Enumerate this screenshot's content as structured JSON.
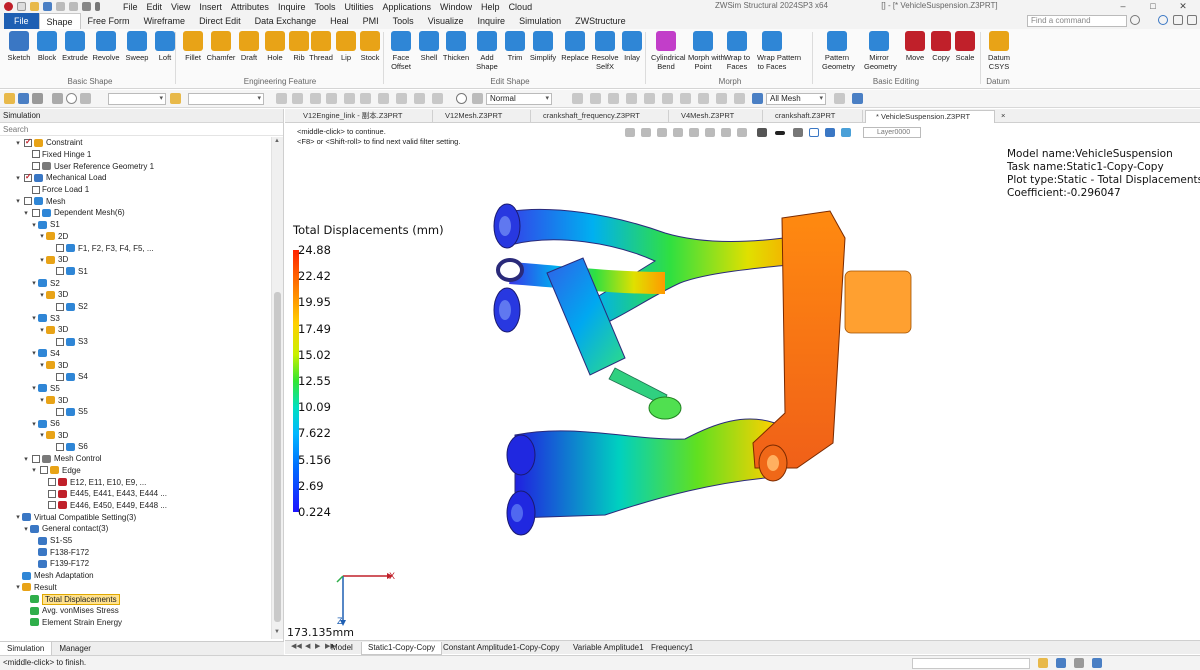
{
  "app": {
    "title": "ZWSim Structural 2024SP3 x64",
    "document": "[] - [* VehicleSuspension.Z3PRT]"
  },
  "menu": [
    "File",
    "Edit",
    "View",
    "Insert",
    "Attributes",
    "Inquire",
    "Tools",
    "Utilities",
    "Applications",
    "Window",
    "Help",
    "Cloud"
  ],
  "ribbon_tabs": [
    {
      "label": "File",
      "style": "file"
    },
    {
      "label": "Shape",
      "style": "active"
    },
    {
      "label": "Free Form",
      "style": ""
    },
    {
      "label": "Wireframe",
      "style": ""
    },
    {
      "label": "Direct Edit",
      "style": ""
    },
    {
      "label": "Data Exchange",
      "style": ""
    },
    {
      "label": "Heal",
      "style": ""
    },
    {
      "label": "PMI",
      "style": ""
    },
    {
      "label": "Tools",
      "style": ""
    },
    {
      "label": "Visualize",
      "style": ""
    },
    {
      "label": "Inquire",
      "style": ""
    },
    {
      "label": "Simulation",
      "style": ""
    },
    {
      "label": "ZWStructure",
      "style": ""
    }
  ],
  "find_command": {
    "placeholder": "Find a command"
  },
  "ribbon": {
    "tools": [
      {
        "label": "Sketch",
        "name": "sketch-icon",
        "color": "#3a77c4"
      },
      {
        "label": "Block",
        "name": "block-icon",
        "color": "#2f86d6"
      },
      {
        "label": "Extrude",
        "name": "extrude-icon",
        "color": "#2f86d6"
      },
      {
        "label": "Revolve",
        "name": "revolve-icon",
        "color": "#2f86d6"
      },
      {
        "label": "Sweep",
        "name": "sweep-icon",
        "color": "#2f86d6"
      },
      {
        "label": "Loft",
        "name": "loft-icon",
        "color": "#2f86d6"
      },
      {
        "label": "Fillet",
        "name": "fillet-icon",
        "color": "#e8a317"
      },
      {
        "label": "Chamfer",
        "name": "chamfer-icon",
        "color": "#e8a317"
      },
      {
        "label": "Draft",
        "name": "draft-icon",
        "color": "#e8a317"
      },
      {
        "label": "Hole",
        "name": "hole-icon",
        "color": "#e8a317"
      },
      {
        "label": "Rib",
        "name": "rib-icon",
        "color": "#e8a317"
      },
      {
        "label": "Thread",
        "name": "thread-icon",
        "color": "#e8a317"
      },
      {
        "label": "Lip",
        "name": "lip-icon",
        "color": "#e8a317"
      },
      {
        "label": "Stock",
        "name": "stock-icon",
        "color": "#e8a317"
      },
      {
        "label": "Face Offset",
        "name": "face-offset-icon",
        "color": "#2f86d6",
        "line2": "Offset"
      },
      {
        "label": "Shell",
        "name": "shell-icon",
        "color": "#2f86d6"
      },
      {
        "label": "Thicken",
        "name": "thicken-icon",
        "color": "#2f86d6"
      },
      {
        "label": "Add Shape",
        "name": "add-shape-icon",
        "color": "#2f86d6",
        "line2": "Shape"
      },
      {
        "label": "Trim",
        "name": "trim-icon",
        "color": "#2f86d6"
      },
      {
        "label": "Simplify",
        "name": "simplify-icon",
        "color": "#2f86d6"
      },
      {
        "label": "Replace",
        "name": "replace-icon",
        "color": "#2f86d6"
      },
      {
        "label": "Resolve SelfX",
        "name": "resolve-selfx-icon",
        "color": "#2f86d6",
        "line2": "SelfX"
      },
      {
        "label": "Inlay",
        "name": "inlay-icon",
        "color": "#2f86d6"
      },
      {
        "label": "Cylindrical Bend",
        "name": "cylindrical-bend-icon",
        "color": "#c23ec9",
        "line2": "Bend"
      },
      {
        "label": "Morph with Point",
        "name": "morph-point-icon",
        "color": "#2f86d6",
        "line2": "Point"
      },
      {
        "label": "Wrap to Faces",
        "name": "wrap-faces-icon",
        "color": "#2f86d6",
        "line2": "Faces"
      },
      {
        "label": "Wrap Pattern to Faces",
        "name": "wrap-pattern-icon",
        "color": "#2f86d6",
        "line2": "to Faces"
      },
      {
        "label": "Pattern Geometry",
        "name": "pattern-geometry-icon",
        "color": "#2f86d6",
        "line2": "Geometry"
      },
      {
        "label": "Mirror Geometry",
        "name": "mirror-geometry-icon",
        "color": "#2f86d6",
        "line2": "Geometry"
      },
      {
        "label": "Move",
        "name": "move-icon",
        "color": "#c0202a"
      },
      {
        "label": "Copy",
        "name": "copy-icon",
        "color": "#c0202a"
      },
      {
        "label": "Scale",
        "name": "scale-icon",
        "color": "#c0202a"
      },
      {
        "label": "Datum CSYS",
        "name": "datum-csys-icon",
        "color": "#e8a317",
        "line2": "CSYS"
      }
    ],
    "groups": [
      "Basic Shape",
      "Engineering Feature",
      "Edit Shape",
      "Morph",
      "Basic Editing",
      "Datum"
    ]
  },
  "toolbar": {
    "filter_combo": "Normal",
    "mesh_combo": "All Mesh"
  },
  "panel": {
    "title": "Simulation",
    "search_placeholder": "Search",
    "tabs": [
      "Simulation",
      "Manager"
    ]
  },
  "tree": [
    {
      "label": "Constraint",
      "depth": 1,
      "exp": "▾",
      "cb": "checked",
      "icon": "constraint-icon",
      "color": "#e8a317"
    },
    {
      "label": "Fixed Hinge 1",
      "depth": 2,
      "exp": "",
      "cb": "empty",
      "icon": "",
      "color": ""
    },
    {
      "label": "User Reference Geometry 1",
      "depth": 2,
      "exp": "",
      "cb": "empty",
      "icon": "reference-geometry-icon",
      "color": "#7a7a7a"
    },
    {
      "label": "Mechanical Load",
      "depth": 1,
      "exp": "▾",
      "cb": "checked",
      "icon": "mechanical-load-icon",
      "color": "#3a77c4"
    },
    {
      "label": "Force Load 1",
      "depth": 2,
      "exp": "",
      "cb": "empty",
      "icon": "",
      "color": ""
    },
    {
      "label": "Mesh",
      "depth": 1,
      "exp": "▾",
      "cb": "empty",
      "icon": "mesh-icon",
      "color": "#2f86d6"
    },
    {
      "label": "Dependent Mesh(6)",
      "depth": 2,
      "exp": "▾",
      "cb": "empty",
      "icon": "dependent-mesh-icon",
      "color": "#2f86d6"
    },
    {
      "label": "S1",
      "depth": 3,
      "exp": "▾",
      "cb": "",
      "icon": "solid-icon",
      "color": "#2f86d6"
    },
    {
      "label": "2D",
      "depth": 4,
      "exp": "▾",
      "cb": "",
      "icon": "mesh-2d-icon",
      "color": "#e8a317"
    },
    {
      "label": "F1, F2, F3, F4, F5, ...",
      "depth": 5,
      "exp": "",
      "cb": "empty",
      "icon": "face-icon",
      "color": "#2f86d6"
    },
    {
      "label": "3D",
      "depth": 4,
      "exp": "▾",
      "cb": "",
      "icon": "mesh-3d-icon",
      "color": "#e8a317"
    },
    {
      "label": "S1",
      "depth": 5,
      "exp": "",
      "cb": "empty",
      "icon": "solid-icon",
      "color": "#2f86d6"
    },
    {
      "label": "S2",
      "depth": 3,
      "exp": "▾",
      "cb": "",
      "icon": "solid-icon",
      "color": "#2f86d6"
    },
    {
      "label": "3D",
      "depth": 4,
      "exp": "▾",
      "cb": "",
      "icon": "mesh-3d-icon",
      "color": "#e8a317"
    },
    {
      "label": "S2",
      "depth": 5,
      "exp": "",
      "cb": "empty",
      "icon": "solid-icon",
      "color": "#2f86d6"
    },
    {
      "label": "S3",
      "depth": 3,
      "exp": "▾",
      "cb": "",
      "icon": "solid-icon",
      "color": "#2f86d6"
    },
    {
      "label": "3D",
      "depth": 4,
      "exp": "▾",
      "cb": "",
      "icon": "mesh-3d-icon",
      "color": "#e8a317"
    },
    {
      "label": "S3",
      "depth": 5,
      "exp": "",
      "cb": "empty",
      "icon": "solid-icon",
      "color": "#2f86d6"
    },
    {
      "label": "S4",
      "depth": 3,
      "exp": "▾",
      "cb": "",
      "icon": "solid-icon",
      "color": "#2f86d6"
    },
    {
      "label": "3D",
      "depth": 4,
      "exp": "▾",
      "cb": "",
      "icon": "mesh-3d-icon",
      "color": "#e8a317"
    },
    {
      "label": "S4",
      "depth": 5,
      "exp": "",
      "cb": "empty",
      "icon": "solid-icon",
      "color": "#2f86d6"
    },
    {
      "label": "S5",
      "depth": 3,
      "exp": "▾",
      "cb": "",
      "icon": "solid-icon",
      "color": "#2f86d6"
    },
    {
      "label": "3D",
      "depth": 4,
      "exp": "▾",
      "cb": "",
      "icon": "mesh-3d-icon",
      "color": "#e8a317"
    },
    {
      "label": "S5",
      "depth": 5,
      "exp": "",
      "cb": "empty",
      "icon": "solid-icon",
      "color": "#2f86d6"
    },
    {
      "label": "S6",
      "depth": 3,
      "exp": "▾",
      "cb": "",
      "icon": "solid-icon",
      "color": "#2f86d6"
    },
    {
      "label": "3D",
      "depth": 4,
      "exp": "▾",
      "cb": "",
      "icon": "mesh-3d-icon",
      "color": "#e8a317"
    },
    {
      "label": "S6",
      "depth": 5,
      "exp": "",
      "cb": "empty",
      "icon": "solid-icon",
      "color": "#2f86d6"
    },
    {
      "label": "Mesh Control",
      "depth": 2,
      "exp": "▾",
      "cb": "empty",
      "icon": "mesh-control-icon",
      "color": "#7a7a7a"
    },
    {
      "label": "Edge",
      "depth": 3,
      "exp": "▾",
      "cb": "empty",
      "icon": "edge-icon",
      "color": "#e8a317"
    },
    {
      "label": "E12, E11, E10, E9, ...",
      "depth": 4,
      "exp": "",
      "cb": "empty",
      "icon": "edge-item-icon",
      "color": "#c0202a"
    },
    {
      "label": "E445, E441, E443, E444 ...",
      "depth": 4,
      "exp": "",
      "cb": "empty",
      "icon": "edge-item-icon",
      "color": "#c0202a"
    },
    {
      "label": "E446, E450, E449, E448 ...",
      "depth": 4,
      "exp": "",
      "cb": "empty",
      "icon": "edge-item-icon",
      "color": "#c0202a"
    },
    {
      "label": "Virtual Compatible Setting(3)",
      "depth": 1,
      "exp": "▾",
      "cb": "",
      "icon": "virtual-compatible-icon",
      "color": "#3a77c4"
    },
    {
      "label": "General contact(3)",
      "depth": 2,
      "exp": "▾",
      "cb": "",
      "icon": "contact-icon",
      "color": "#3a77c4"
    },
    {
      "label": "S1-S5",
      "depth": 3,
      "exp": "",
      "cb": "",
      "icon": "contact-pair-icon",
      "color": "#3a77c4"
    },
    {
      "label": "F138-F172",
      "depth": 3,
      "exp": "",
      "cb": "",
      "icon": "contact-pair-icon",
      "color": "#3a77c4"
    },
    {
      "label": "F139-F172",
      "depth": 3,
      "exp": "",
      "cb": "",
      "icon": "contact-pair-icon",
      "color": "#3a77c4"
    },
    {
      "label": "Mesh Adaptation",
      "depth": 1,
      "exp": "",
      "cb": "",
      "icon": "mesh-adaptation-icon",
      "color": "#2f86d6"
    },
    {
      "label": "Result",
      "depth": 1,
      "exp": "▾",
      "cb": "",
      "icon": "result-icon",
      "color": "#e8a317"
    },
    {
      "label": "Total Displacements",
      "depth": 2,
      "exp": "",
      "cb": "",
      "icon": "total-displacement-icon",
      "color": "#2fae4a",
      "selected": true
    },
    {
      "label": "Avg. vonMises Stress",
      "depth": 2,
      "exp": "",
      "cb": "",
      "icon": "vonmises-icon",
      "color": "#2fae4a"
    },
    {
      "label": "Element Strain Energy",
      "depth": 2,
      "exp": "",
      "cb": "",
      "icon": "strain-energy-icon",
      "color": "#2fae4a"
    }
  ],
  "doc_tabs": [
    {
      "label": "V12Engine_link - 副本.Z3PRT",
      "active": false
    },
    {
      "label": "V12Mesh.Z3PRT",
      "active": false
    },
    {
      "label": "crankshaft_frequency.Z3PRT",
      "active": false
    },
    {
      "label": "V4Mesh.Z3PRT",
      "active": false
    },
    {
      "label": "crankshaft.Z3PRT",
      "active": false
    },
    {
      "label": "* VehicleSuspension.Z3PRT",
      "active": true
    }
  ],
  "viewport": {
    "hint_line1": "<middle-click> to continue.",
    "hint_line2": "<F8> or <Shift-roll> to find next valid filter setting.",
    "layer": "Layer0000",
    "info": {
      "model_name": "Model name:VehicleSuspension",
      "task_name": "Task name:Static1-Copy-Copy",
      "plot_type": "Plot type:Static - Total Displacements",
      "coefficient": "Coefficient:-0.296047"
    },
    "legend": {
      "title": "Total Displacements (mm)",
      "ticks": [
        "24.88",
        "22.42",
        "19.95",
        "17.49",
        "15.02",
        "12.55",
        "10.09",
        "7.622",
        "5.156",
        "2.69",
        "0.224"
      ],
      "max": 24.88,
      "min": 0.224
    },
    "scale_label": "173.135mm",
    "axes": {
      "x": "X",
      "z": "Z"
    }
  },
  "sheet_tabs": [
    {
      "label": "Model",
      "active": false
    },
    {
      "label": "Static1-Copy-Copy",
      "active": true
    },
    {
      "label": "Constant Amplitude1-Copy-Copy",
      "active": false
    },
    {
      "label": "Variable Amplitude1",
      "active": false
    },
    {
      "label": "Frequency1",
      "active": false
    }
  ],
  "status": {
    "text": "<middle-click> to finish."
  },
  "colors": {
    "accent": "#1e5fb3",
    "selection": "#ffe28f",
    "legend_max": "#ff2200",
    "legend_min": "#1e14ff"
  }
}
